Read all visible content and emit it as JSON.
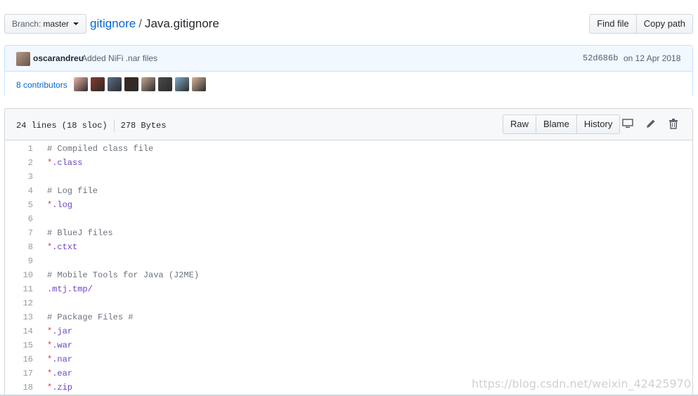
{
  "branch": {
    "label": "Branch:",
    "value": "master"
  },
  "breadcrumb": {
    "repo": "gitignore",
    "separator": "/",
    "file": "Java.gitignore"
  },
  "header_buttons": {
    "find_file": "Find file",
    "copy_path": "Copy path"
  },
  "commit": {
    "author": "oscarandreu",
    "message": "Added NiFi .nar files",
    "sha": "52d686b",
    "date": "on 12 Apr 2018"
  },
  "contributors": {
    "label": "8 contributors",
    "avatar_colors": [
      "#f0b0a8",
      "#8a3a2a",
      "#5b6e8c",
      "#3b2a1f",
      "#c4a88e",
      "#4a4a4a",
      "#7fa9c9",
      "#d9b49a"
    ]
  },
  "file": {
    "lines_info": "24 lines (18 sloc)",
    "size": "278 Bytes",
    "actions": {
      "raw": "Raw",
      "blame": "Blame",
      "history": "History"
    },
    "icons": [
      "desktop-icon",
      "pencil-icon",
      "trash-icon"
    ]
  },
  "code_lines": [
    {
      "n": "1",
      "text": "# Compiled class file",
      "kind": "comment"
    },
    {
      "n": "2",
      "text": "*.class",
      "kind": "pattern"
    },
    {
      "n": "3",
      "text": "",
      "kind": "blank"
    },
    {
      "n": "4",
      "text": "# Log file",
      "kind": "comment"
    },
    {
      "n": "5",
      "text": "*.log",
      "kind": "pattern"
    },
    {
      "n": "6",
      "text": "",
      "kind": "blank"
    },
    {
      "n": "7",
      "text": "# BlueJ files",
      "kind": "comment"
    },
    {
      "n": "8",
      "text": "*.ctxt",
      "kind": "pattern"
    },
    {
      "n": "9",
      "text": "",
      "kind": "blank"
    },
    {
      "n": "10",
      "text": "# Mobile Tools for Java (J2ME)",
      "kind": "comment"
    },
    {
      "n": "11",
      "text": ".mtj.tmp/",
      "kind": "pattern"
    },
    {
      "n": "12",
      "text": "",
      "kind": "blank"
    },
    {
      "n": "13",
      "text": "# Package Files #",
      "kind": "comment"
    },
    {
      "n": "14",
      "text": "*.jar",
      "kind": "pattern"
    },
    {
      "n": "15",
      "text": "*.war",
      "kind": "pattern"
    },
    {
      "n": "16",
      "text": "*.nar",
      "kind": "pattern"
    },
    {
      "n": "17",
      "text": "*.ear",
      "kind": "pattern"
    },
    {
      "n": "18",
      "text": "*.zip",
      "kind": "pattern"
    }
  ],
  "watermark": "https://blog.csdn.net/weixin_42425970"
}
